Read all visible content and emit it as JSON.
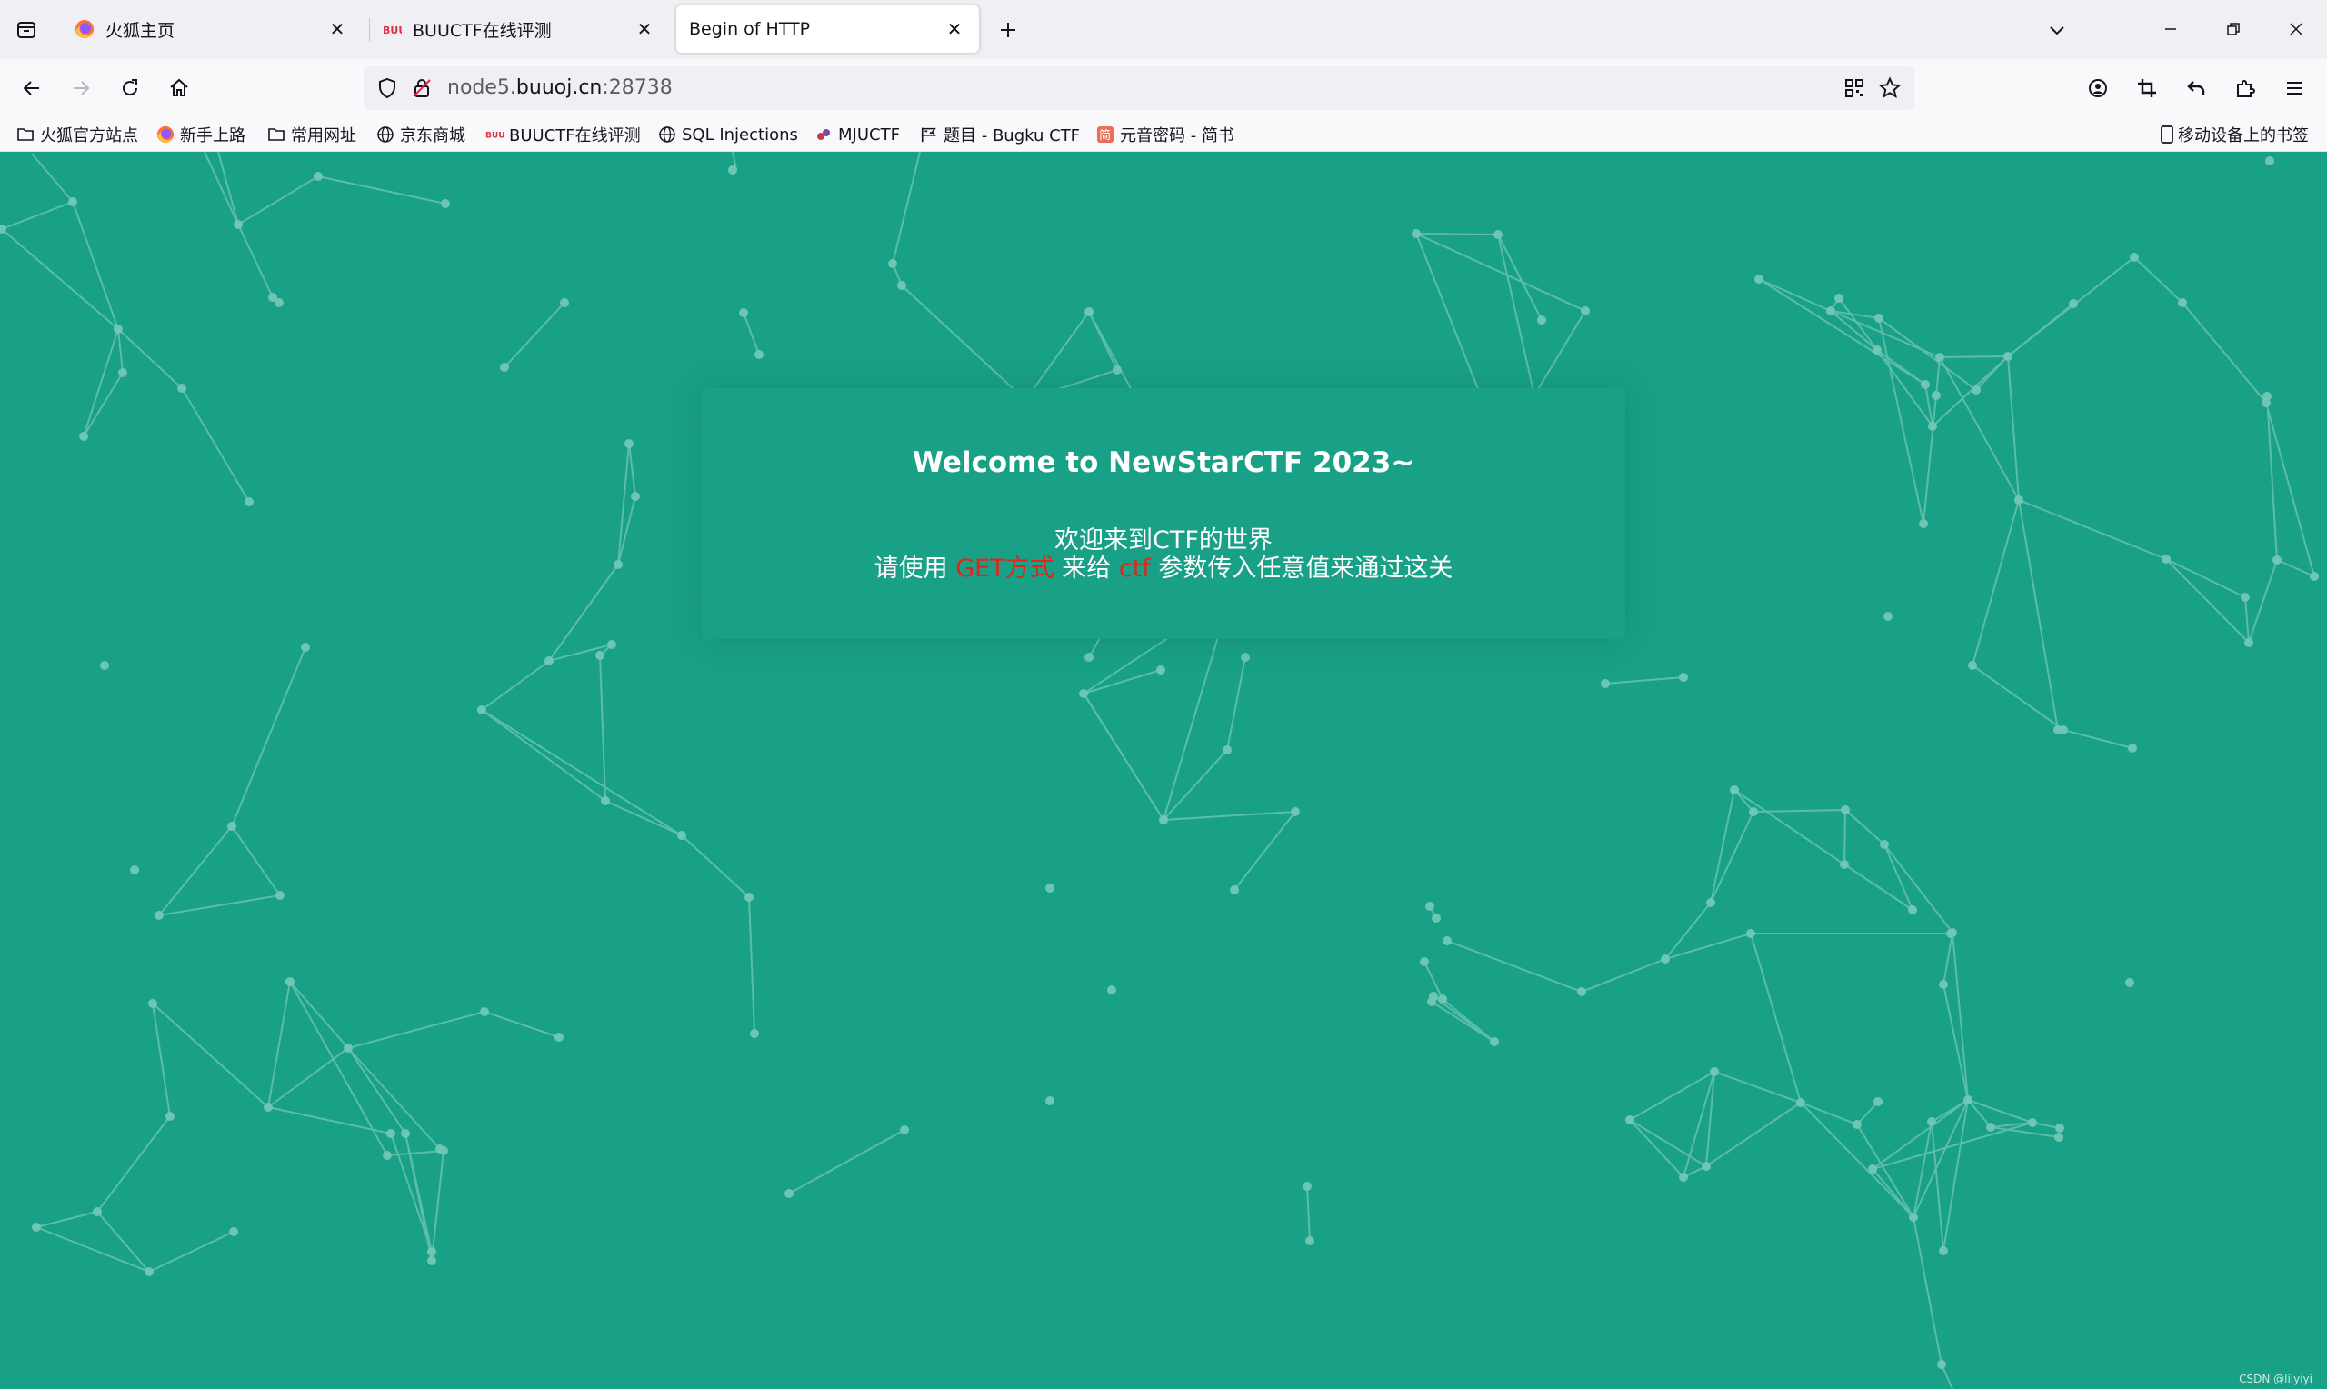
{
  "browser": {
    "tabs": [
      {
        "title": "火狐主页",
        "icon": "firefox-icon",
        "active": false
      },
      {
        "title": "BUUCTF在线评测",
        "icon": "buuctf-icon",
        "active": false
      },
      {
        "title": "Begin of HTTP",
        "icon": "none",
        "active": true
      }
    ],
    "url": {
      "prefix": "node5.",
      "host": "buuoj.cn",
      "port": ":28738"
    },
    "bookmarks": [
      {
        "label": "火狐官方站点",
        "icon": "folder-icon"
      },
      {
        "label": "新手上路",
        "icon": "firefox-icon"
      },
      {
        "label": "常用网址",
        "icon": "folder-icon"
      },
      {
        "label": "京东商城",
        "icon": "globe-icon"
      },
      {
        "label": "BUUCTF在线评测",
        "icon": "buuctf-icon"
      },
      {
        "label": "SQL Injections",
        "icon": "globe-icon"
      },
      {
        "label": "MJUCTF",
        "icon": "mjuctf-icon"
      },
      {
        "label": "题目 - Bugku CTF",
        "icon": "flag-icon"
      },
      {
        "label": "元音密码 - 简书",
        "icon": "jianshu-icon"
      }
    ],
    "mobile_bookmarks": "移动设备上的书签"
  },
  "page": {
    "background_color": "#18a187",
    "heading": "Welcome to NewStarCTF 2023~",
    "line1": "欢迎来到CTF的世界",
    "line2": {
      "part1": "请使用 ",
      "highlight1": "GET方式",
      "part2": " 来给 ",
      "highlight2": "ctf",
      "part3": " 参数传入任意值来通过这关"
    },
    "highlight_color": "#e0261a",
    "watermark": "CSDN @lilyiyi"
  }
}
